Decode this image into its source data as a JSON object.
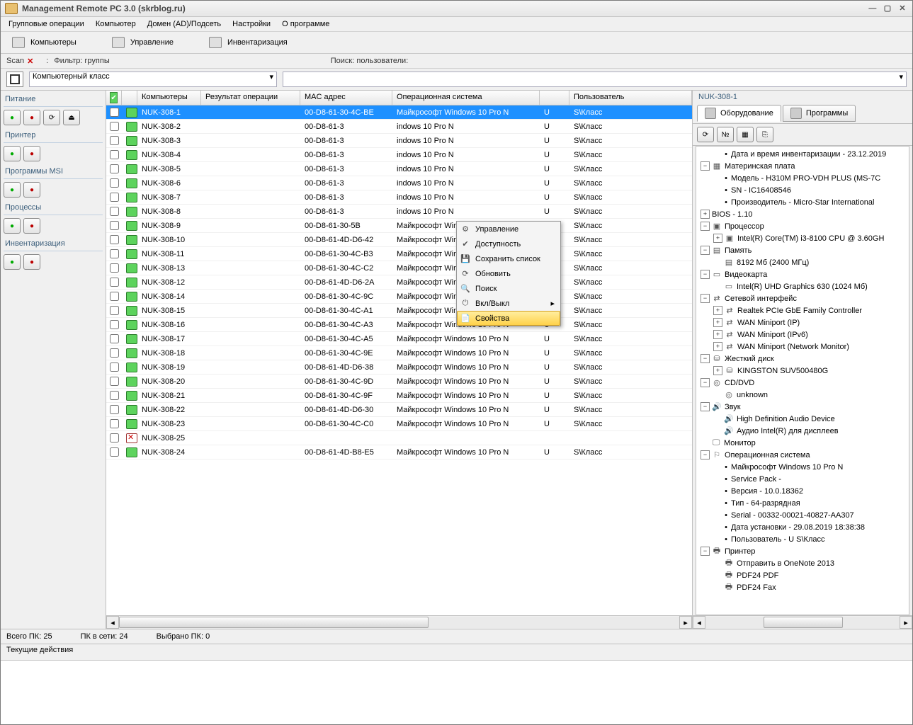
{
  "window": {
    "title": "Management Remote PC 3.0 (skrblog.ru)"
  },
  "menubar": [
    "Групповые операции",
    "Компьютер",
    "Домен (AD)/Подсеть",
    "Настройки",
    "О программе"
  ],
  "main_tabs": [
    {
      "label": "Компьютеры"
    },
    {
      "label": "Управление"
    },
    {
      "label": "Инвентаризация"
    }
  ],
  "filter": {
    "scan_label": "Scan",
    "filter_label": "Фильтр: группы",
    "search_label": "Поиск: пользователи:"
  },
  "combos": {
    "group_value": "Компьютерный класс"
  },
  "sidebar": {
    "groups": [
      {
        "title": "Питание",
        "buttons": [
          "power-on",
          "power-off",
          "restart",
          "lock"
        ]
      },
      {
        "title": "Принтер",
        "buttons": [
          "print",
          "print-settings"
        ]
      },
      {
        "title": "Программы MSI",
        "buttons": [
          "install",
          "uninstall"
        ]
      },
      {
        "title": "Процессы",
        "buttons": [
          "proc-list",
          "proc-kill"
        ]
      },
      {
        "title": "Инвентаризация",
        "buttons": [
          "inv-hw",
          "inv-sw"
        ]
      }
    ]
  },
  "grid": {
    "columns": [
      "Компьютеры",
      "Результат операции",
      "MAC адрес",
      "Операционная система",
      "",
      "Пользователь"
    ],
    "rows": [
      {
        "name": "NUK-308-1",
        "mac": "00-D8-61-30-4C-BE",
        "os": "Майкрософт Windows 10 Pro N",
        "u": "U",
        "user": "S\\Класс",
        "sel": true
      },
      {
        "name": "NUK-308-2",
        "mac": "00-D8-61-3",
        "os": "indows 10 Pro N",
        "u": "U",
        "user": "S\\Класс"
      },
      {
        "name": "NUK-308-3",
        "mac": "00-D8-61-3",
        "os": "indows 10 Pro N",
        "u": "U",
        "user": "S\\Класс"
      },
      {
        "name": "NUK-308-4",
        "mac": "00-D8-61-3",
        "os": "indows 10 Pro N",
        "u": "U",
        "user": "S\\Класс"
      },
      {
        "name": "NUK-308-5",
        "mac": "00-D8-61-3",
        "os": "indows 10 Pro N",
        "u": "U",
        "user": "S\\Класс"
      },
      {
        "name": "NUK-308-6",
        "mac": "00-D8-61-3",
        "os": "indows 10 Pro N",
        "u": "U",
        "user": "S\\Класс"
      },
      {
        "name": "NUK-308-7",
        "mac": "00-D8-61-3",
        "os": "indows 10 Pro N",
        "u": "U",
        "user": "S\\Класс"
      },
      {
        "name": "NUK-308-8",
        "mac": "00-D8-61-3",
        "os": "indows 10 Pro N",
        "u": "U",
        "user": "S\\Класс"
      },
      {
        "name": "NUK-308-9",
        "mac": "00-D8-61-30-5B",
        "os": "Майкрософт Windows 10 Pro N",
        "u": "U",
        "user": "S\\Класс"
      },
      {
        "name": "NUK-308-10",
        "mac": "00-D8-61-4D-D6-42",
        "os": "Майкрософт Windows 10 Pro N",
        "u": "U",
        "user": "S\\Класс"
      },
      {
        "name": "NUK-308-11",
        "mac": "00-D8-61-30-4C-B3",
        "os": "Майкрософт Windows 10 Pro N",
        "u": "U",
        "user": "S\\Класс"
      },
      {
        "name": "NUK-308-13",
        "mac": "00-D8-61-30-4C-C2",
        "os": "Майкрософт Windows 10 Pro N",
        "u": "U",
        "user": "S\\Класс"
      },
      {
        "name": "NUK-308-12",
        "mac": "00-D8-61-4D-D6-2A",
        "os": "Майкрософт Windows 10 Pro N",
        "u": "U",
        "user": "S\\Класс"
      },
      {
        "name": "NUK-308-14",
        "mac": "00-D8-61-30-4C-9C",
        "os": "Майкрософт Windows 10 Pro N",
        "u": "U",
        "user": "S\\Класс"
      },
      {
        "name": "NUK-308-15",
        "mac": "00-D8-61-30-4C-A1",
        "os": "Майкрософт Windows 10 Pro N",
        "u": "U",
        "user": "S\\Класс"
      },
      {
        "name": "NUK-308-16",
        "mac": "00-D8-61-30-4C-A3",
        "os": "Майкрософт Windows 10 Pro N",
        "u": "U",
        "user": "S\\Класс"
      },
      {
        "name": "NUK-308-17",
        "mac": "00-D8-61-30-4C-A5",
        "os": "Майкрософт Windows 10 Pro N",
        "u": "U",
        "user": "S\\Класс"
      },
      {
        "name": "NUK-308-18",
        "mac": "00-D8-61-30-4C-9E",
        "os": "Майкрософт Windows 10 Pro N",
        "u": "U",
        "user": "S\\Класс"
      },
      {
        "name": "NUK-308-19",
        "mac": "00-D8-61-4D-D6-38",
        "os": "Майкрософт Windows 10 Pro N",
        "u": "U",
        "user": "S\\Класс"
      },
      {
        "name": "NUK-308-20",
        "mac": "00-D8-61-30-4C-9D",
        "os": "Майкрософт Windows 10 Pro N",
        "u": "U",
        "user": "S\\Класс"
      },
      {
        "name": "NUK-308-21",
        "mac": "00-D8-61-30-4C-9F",
        "os": "Майкрософт Windows 10 Pro N",
        "u": "U",
        "user": "S\\Класс"
      },
      {
        "name": "NUK-308-22",
        "mac": "00-D8-61-4D-D6-30",
        "os": "Майкрософт Windows 10 Pro N",
        "u": "U",
        "user": "S\\Класс"
      },
      {
        "name": "NUK-308-23",
        "mac": "00-D8-61-30-4C-C0",
        "os": "Майкрософт Windows 10 Pro N",
        "u": "U",
        "user": "S\\Класс"
      },
      {
        "name": "NUK-308-25",
        "mac": "",
        "os": "",
        "u": "",
        "user": "",
        "off": true
      },
      {
        "name": "NUK-308-24",
        "mac": "00-D8-61-4D-B8-E5",
        "os": "Майкрософт Windows 10 Pro N",
        "u": "U",
        "user": "S\\Класс"
      }
    ]
  },
  "context_menu": [
    {
      "label": "Управление",
      "icon": "⚙"
    },
    {
      "label": "Доступность",
      "icon": "✔"
    },
    {
      "label": "Сохранить список",
      "icon": "💾"
    },
    {
      "label": "Обновить",
      "icon": "⟳"
    },
    {
      "label": "Поиск",
      "icon": "🔍"
    },
    {
      "label": "Вкл/Выкл",
      "icon": "⏻",
      "sub": true
    },
    {
      "label": "Свойства",
      "icon": "📄",
      "hov": true
    }
  ],
  "right": {
    "title": "NUK-308-1",
    "tabs": [
      {
        "label": "Оборудование",
        "active": true
      },
      {
        "label": "Программы"
      }
    ],
    "tree": [
      {
        "d": 1,
        "t": "b",
        "label": "Дата и время инвентаризации - 23.12.2019"
      },
      {
        "d": 0,
        "t": "e",
        "icon": "▦",
        "label": "Материнская плата"
      },
      {
        "d": 1,
        "t": "b",
        "label": "Модель - H310M PRO-VDH PLUS (MS-7C"
      },
      {
        "d": 1,
        "t": "b",
        "label": "SN - IC16408546"
      },
      {
        "d": 1,
        "t": "b",
        "label": "Производитель - Micro-Star International"
      },
      {
        "d": 0,
        "t": "p",
        "label": "BIOS - 1.10"
      },
      {
        "d": 0,
        "t": "e",
        "icon": "▣",
        "label": "Процессор"
      },
      {
        "d": 1,
        "t": "p",
        "icon": "▣",
        "label": "Intel(R) Core(TM) i3-8100 CPU @ 3.60GH"
      },
      {
        "d": 0,
        "t": "e",
        "icon": "▤",
        "label": "Память"
      },
      {
        "d": 1,
        "t": "n",
        "icon": "▤",
        "label": "8192 Мб (2400 МГц)"
      },
      {
        "d": 0,
        "t": "e",
        "icon": "▭",
        "label": "Видеокарта"
      },
      {
        "d": 1,
        "t": "n",
        "icon": "▭",
        "label": "Intel(R) UHD Graphics 630 (1024 Мб)"
      },
      {
        "d": 0,
        "t": "e",
        "icon": "⇄",
        "label": "Сетевой интерфейс"
      },
      {
        "d": 1,
        "t": "p",
        "icon": "⇄",
        "label": "Realtek PCIe GbE Family Controller"
      },
      {
        "d": 1,
        "t": "p",
        "icon": "⇄",
        "label": "WAN Miniport (IP)"
      },
      {
        "d": 1,
        "t": "p",
        "icon": "⇄",
        "label": "WAN Miniport (IPv6)"
      },
      {
        "d": 1,
        "t": "p",
        "icon": "⇄",
        "label": "WAN Miniport (Network Monitor)"
      },
      {
        "d": 0,
        "t": "e",
        "icon": "⛁",
        "label": "Жесткий диск"
      },
      {
        "d": 1,
        "t": "p",
        "icon": "⛁",
        "label": "KINGSTON SUV500480G"
      },
      {
        "d": 0,
        "t": "e",
        "icon": "◎",
        "label": "CD/DVD"
      },
      {
        "d": 1,
        "t": "n",
        "icon": "◎",
        "label": "unknown"
      },
      {
        "d": 0,
        "t": "e",
        "icon": "🔊",
        "label": "Звук"
      },
      {
        "d": 1,
        "t": "n",
        "icon": "🔊",
        "label": "High Definition Audio Device"
      },
      {
        "d": 1,
        "t": "n",
        "icon": "🔊",
        "label": "Аудио Intel(R) для дисплеев"
      },
      {
        "d": 0,
        "t": "n",
        "icon": "🖵",
        "label": "Монитор"
      },
      {
        "d": 0,
        "t": "e",
        "icon": "⚐",
        "label": "Операционная система"
      },
      {
        "d": 1,
        "t": "b",
        "label": "Майкрософт Windows 10 Pro N"
      },
      {
        "d": 1,
        "t": "b",
        "label": "Service Pack -"
      },
      {
        "d": 1,
        "t": "b",
        "label": "Версия - 10.0.18362"
      },
      {
        "d": 1,
        "t": "b",
        "label": "Тип - 64-разрядная"
      },
      {
        "d": 1,
        "t": "b",
        "label": "Serial - 00332-00021-40827-AA307"
      },
      {
        "d": 1,
        "t": "b",
        "label": "Дата установки - 29.08.2019 18:38:38"
      },
      {
        "d": 1,
        "t": "b",
        "label": "Пользователь - U       S\\Класс"
      },
      {
        "d": 0,
        "t": "e",
        "icon": "🖶",
        "label": "Принтер"
      },
      {
        "d": 1,
        "t": "n",
        "icon": "🖶",
        "label": "Отправить в OneNote 2013"
      },
      {
        "d": 1,
        "t": "n",
        "icon": "🖶",
        "label": "PDF24 PDF"
      },
      {
        "d": 1,
        "t": "n",
        "icon": "🖶",
        "label": "PDF24 Fax"
      }
    ]
  },
  "status": {
    "total": "Всего ПК: 25",
    "online": "ПК в сети: 24",
    "selected": "Выбрано ПК: 0"
  },
  "actions_label": "Текущие действия"
}
